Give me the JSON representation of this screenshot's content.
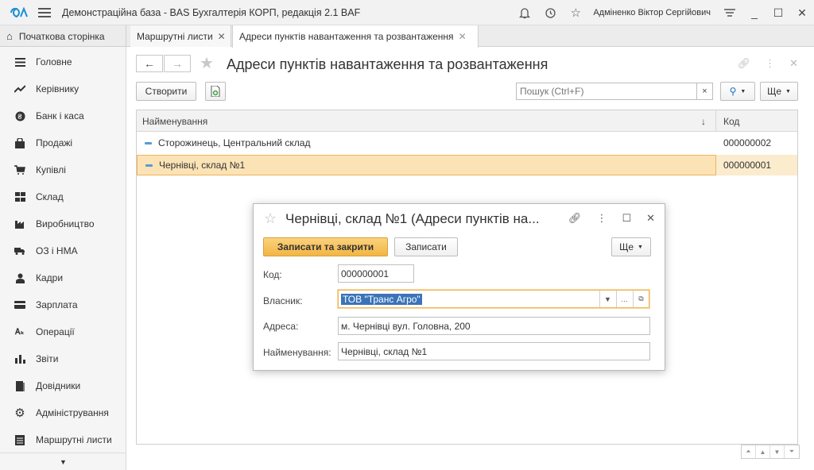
{
  "titlebar": {
    "app_title": "Демонстраційна база - BAS Бухгалтерія КОРП, редакція 2.1 BAF",
    "user": "Адміненко Віктор Сергійович"
  },
  "tabs": [
    {
      "label": "Початкова сторінка"
    },
    {
      "label": "Маршрутні листи"
    },
    {
      "label": "Адреси пунктів навантаження та розвантаження"
    }
  ],
  "sidebar": {
    "items": [
      {
        "label": "Головне",
        "icon": "list-icon"
      },
      {
        "label": "Керівнику",
        "icon": "trend-icon"
      },
      {
        "label": "Банк і каса",
        "icon": "coin-icon"
      },
      {
        "label": "Продажі",
        "icon": "bag-icon"
      },
      {
        "label": "Купівлі",
        "icon": "cart-icon"
      },
      {
        "label": "Склад",
        "icon": "warehouse-icon"
      },
      {
        "label": "Виробництво",
        "icon": "factory-icon"
      },
      {
        "label": "ОЗ і НМА",
        "icon": "truck-icon"
      },
      {
        "label": "Кадри",
        "icon": "person-icon"
      },
      {
        "label": "Зарплата",
        "icon": "wallet-icon"
      },
      {
        "label": "Операції",
        "icon": "operations-icon"
      },
      {
        "label": "Звіти",
        "icon": "bar-chart-icon"
      },
      {
        "label": "Довідники",
        "icon": "book-icon"
      },
      {
        "label": "Адміністрування",
        "icon": "gear-icon"
      },
      {
        "label": "Маршрутні листи",
        "icon": "route-sheet-icon"
      }
    ]
  },
  "main": {
    "title": "Адреси пунктів навантаження та розвантаження",
    "create_label": "Створити",
    "search_placeholder": "Пошук (Ctrl+F)",
    "search_clear": "×",
    "more_label": "Ще",
    "columns": {
      "name": "Найменування",
      "code": "Код"
    },
    "rows": [
      {
        "name": "Сторожинець, Центральний склад",
        "code": "000000002"
      },
      {
        "name": "Чернівці, склад №1",
        "code": "000000001"
      }
    ]
  },
  "dialog": {
    "title": "Чернівці, склад №1 (Адреси пунктів на...",
    "save_close_label": "Записати та закрити",
    "save_label": "Записати",
    "more_label": "Ще",
    "fields": {
      "code_label": "Код:",
      "code_value": "000000001",
      "owner_label": "Власник:",
      "owner_value": "ТОВ \"Транс Агро\"",
      "address_label": "Адреса:",
      "address_value": "м. Чернівці вул. Головна, 200",
      "name_label": "Найменування:",
      "name_value": "Чернівці, склад №1"
    }
  },
  "colors": {
    "accent": "#f2b544",
    "selection": "#fbe3b6",
    "selection_border": "#efb45a"
  }
}
